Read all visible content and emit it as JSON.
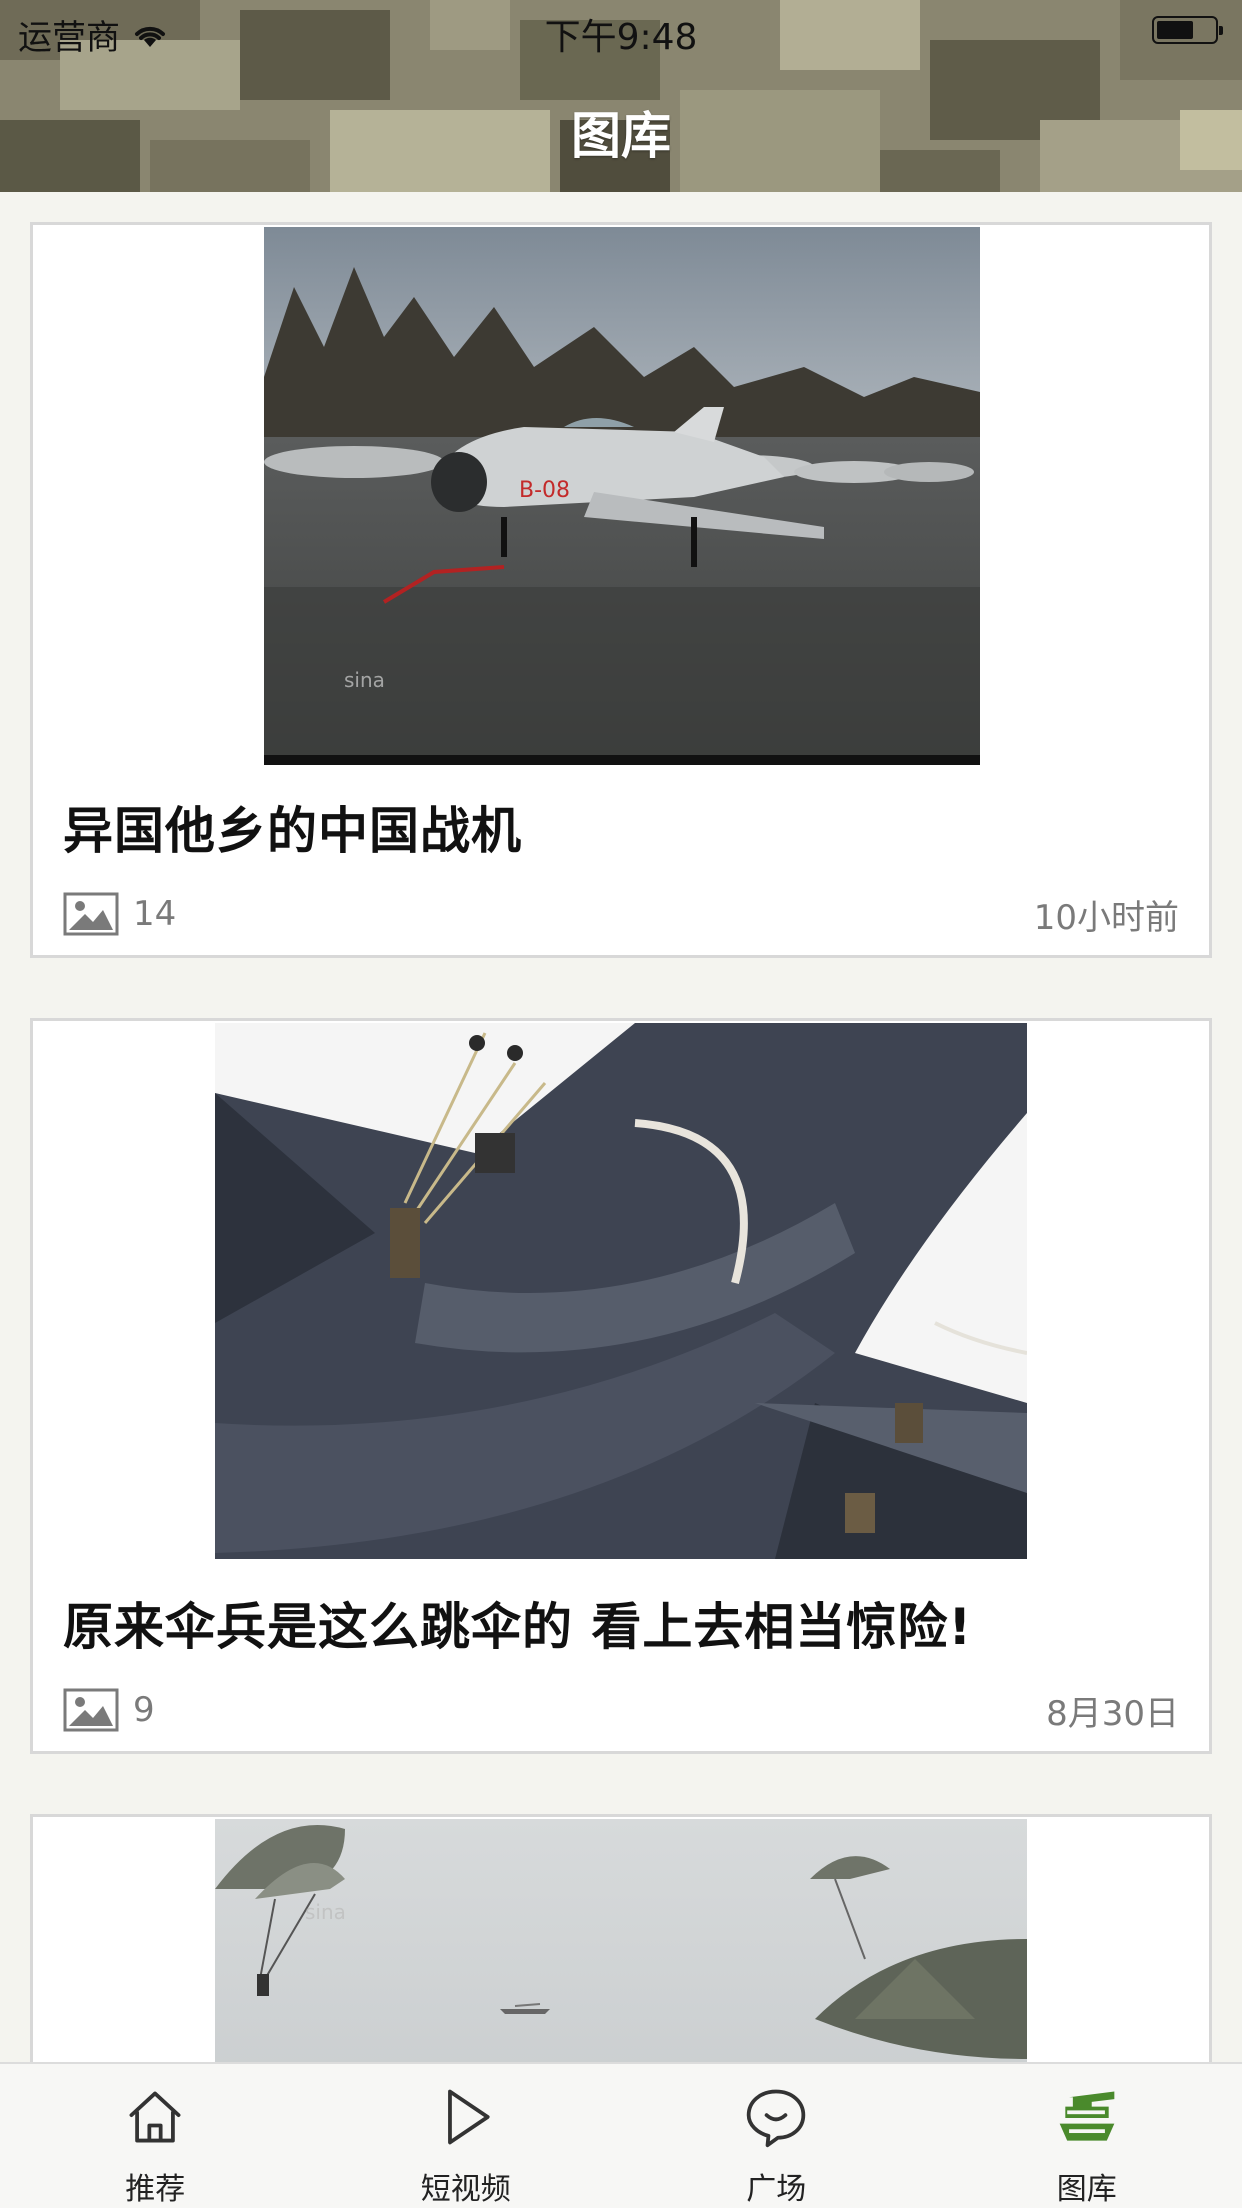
{
  "status_bar": {
    "carrier": "运营商",
    "time": "下午9:48"
  },
  "header": {
    "title": "图库"
  },
  "cards": [
    {
      "title": "异国他乡的中国战机",
      "image_count": "14",
      "time": "10小时前",
      "image_desc": "row of silver jet fighters parked on wet tarmac"
    },
    {
      "title": "原来伞兵是这么跳伞的 看上去相当惊险!",
      "image_count": "9",
      "time": "8月30日",
      "image_desc": "paratroopers jumping from the rear door of a grey transport aircraft"
    },
    {
      "title": "",
      "image_count": "",
      "time": "",
      "image_desc": "olive parachutes descending in cloudy sky"
    }
  ],
  "tabbar": {
    "items": [
      {
        "label": "推荐",
        "icon": "home-icon"
      },
      {
        "label": "短视频",
        "icon": "play-icon"
      },
      {
        "label": "广场",
        "icon": "chat-bubble-icon"
      },
      {
        "label": "图库",
        "icon": "tank-icon",
        "active": true
      }
    ],
    "active_color": "#4a8a2c"
  }
}
